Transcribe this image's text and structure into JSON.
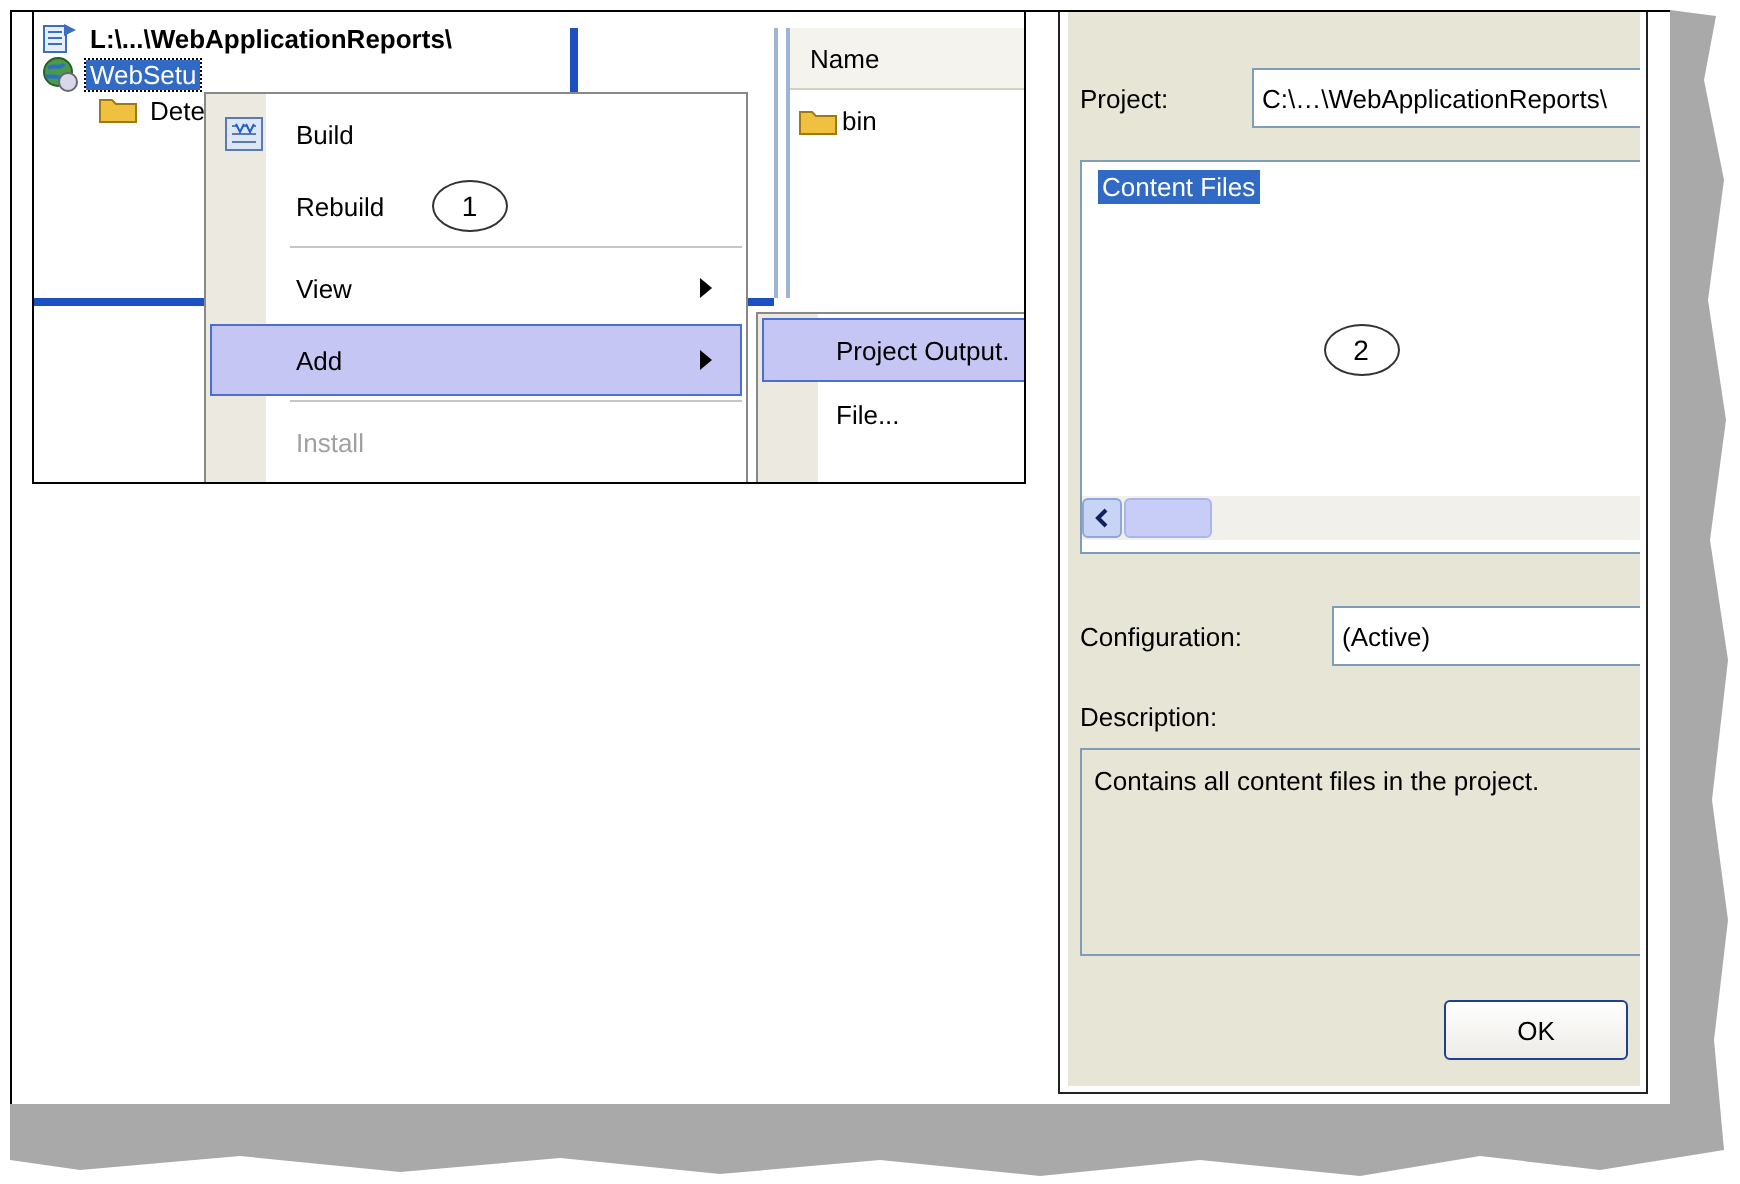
{
  "tree": {
    "items": [
      {
        "label": "L:\\...\\WebApplicationReports\\",
        "kind": "project",
        "selected": false
      },
      {
        "label": "WebSetu",
        "kind": "setup",
        "selected": true,
        "children": [
          {
            "label": "Dete",
            "kind": "folder",
            "selected": false
          }
        ]
      }
    ]
  },
  "list": {
    "columns": [
      "Name"
    ],
    "rows": [
      {
        "name": "bin"
      }
    ]
  },
  "context_menu": {
    "items": [
      {
        "kind": "item",
        "label": "Build",
        "icon": true,
        "selected": false,
        "disabled": false
      },
      {
        "kind": "item",
        "label": "Rebuild",
        "icon": false,
        "selected": false,
        "disabled": false,
        "callout": "1"
      },
      {
        "kind": "separator"
      },
      {
        "kind": "submenu",
        "label": "View",
        "icon": false,
        "selected": false,
        "disabled": false
      },
      {
        "kind": "submenu",
        "label": "Add",
        "icon": false,
        "selected": true,
        "disabled": false
      },
      {
        "kind": "separator"
      },
      {
        "kind": "item",
        "label": "Install",
        "icon": false,
        "selected": false,
        "disabled": true
      }
    ]
  },
  "submenu": {
    "items": [
      {
        "label": "Project Output.",
        "selected": true
      },
      {
        "label": "File...",
        "selected": false
      }
    ]
  },
  "dialog": {
    "project_label": "Project:",
    "project_value": "C:\\…\\WebApplicationReports\\",
    "outputs": [
      {
        "label": "Content Files",
        "selected": true
      }
    ],
    "callout": "2",
    "configuration_label": "Configuration:",
    "configuration_value": "(Active)",
    "description_label": "Description:",
    "description": "Contains all content files in the project.",
    "ok": "OK"
  }
}
